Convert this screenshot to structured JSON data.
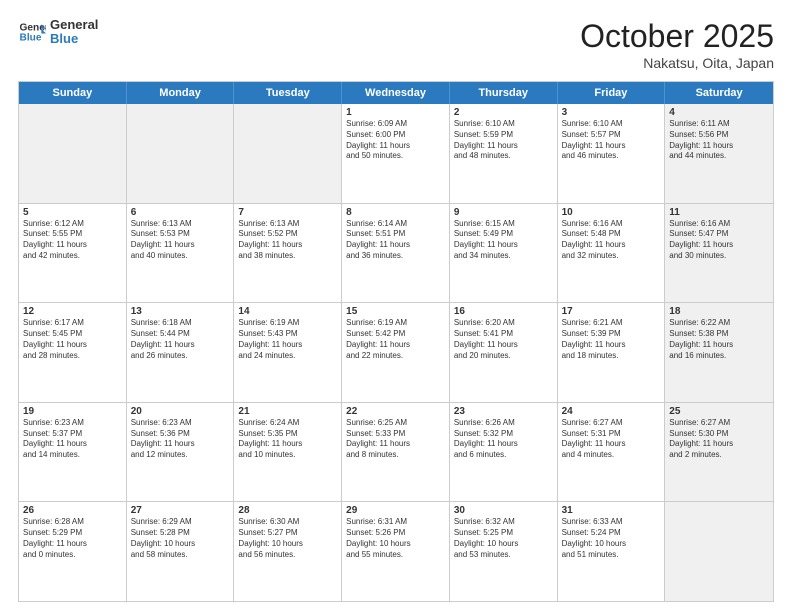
{
  "header": {
    "logo_general": "General",
    "logo_blue": "Blue",
    "month_title": "October 2025",
    "location": "Nakatsu, Oita, Japan"
  },
  "weekdays": [
    "Sunday",
    "Monday",
    "Tuesday",
    "Wednesday",
    "Thursday",
    "Friday",
    "Saturday"
  ],
  "rows": [
    [
      {
        "day": "",
        "info": "",
        "shaded": true
      },
      {
        "day": "",
        "info": "",
        "shaded": true
      },
      {
        "day": "",
        "info": "",
        "shaded": true
      },
      {
        "day": "1",
        "info": "Sunrise: 6:09 AM\nSunset: 6:00 PM\nDaylight: 11 hours\nand 50 minutes."
      },
      {
        "day": "2",
        "info": "Sunrise: 6:10 AM\nSunset: 5:59 PM\nDaylight: 11 hours\nand 48 minutes."
      },
      {
        "day": "3",
        "info": "Sunrise: 6:10 AM\nSunset: 5:57 PM\nDaylight: 11 hours\nand 46 minutes."
      },
      {
        "day": "4",
        "info": "Sunrise: 6:11 AM\nSunset: 5:56 PM\nDaylight: 11 hours\nand 44 minutes.",
        "shaded": true
      }
    ],
    [
      {
        "day": "5",
        "info": "Sunrise: 6:12 AM\nSunset: 5:55 PM\nDaylight: 11 hours\nand 42 minutes."
      },
      {
        "day": "6",
        "info": "Sunrise: 6:13 AM\nSunset: 5:53 PM\nDaylight: 11 hours\nand 40 minutes."
      },
      {
        "day": "7",
        "info": "Sunrise: 6:13 AM\nSunset: 5:52 PM\nDaylight: 11 hours\nand 38 minutes."
      },
      {
        "day": "8",
        "info": "Sunrise: 6:14 AM\nSunset: 5:51 PM\nDaylight: 11 hours\nand 36 minutes."
      },
      {
        "day": "9",
        "info": "Sunrise: 6:15 AM\nSunset: 5:49 PM\nDaylight: 11 hours\nand 34 minutes."
      },
      {
        "day": "10",
        "info": "Sunrise: 6:16 AM\nSunset: 5:48 PM\nDaylight: 11 hours\nand 32 minutes."
      },
      {
        "day": "11",
        "info": "Sunrise: 6:16 AM\nSunset: 5:47 PM\nDaylight: 11 hours\nand 30 minutes.",
        "shaded": true
      }
    ],
    [
      {
        "day": "12",
        "info": "Sunrise: 6:17 AM\nSunset: 5:45 PM\nDaylight: 11 hours\nand 28 minutes."
      },
      {
        "day": "13",
        "info": "Sunrise: 6:18 AM\nSunset: 5:44 PM\nDaylight: 11 hours\nand 26 minutes."
      },
      {
        "day": "14",
        "info": "Sunrise: 6:19 AM\nSunset: 5:43 PM\nDaylight: 11 hours\nand 24 minutes."
      },
      {
        "day": "15",
        "info": "Sunrise: 6:19 AM\nSunset: 5:42 PM\nDaylight: 11 hours\nand 22 minutes."
      },
      {
        "day": "16",
        "info": "Sunrise: 6:20 AM\nSunset: 5:41 PM\nDaylight: 11 hours\nand 20 minutes."
      },
      {
        "day": "17",
        "info": "Sunrise: 6:21 AM\nSunset: 5:39 PM\nDaylight: 11 hours\nand 18 minutes."
      },
      {
        "day": "18",
        "info": "Sunrise: 6:22 AM\nSunset: 5:38 PM\nDaylight: 11 hours\nand 16 minutes.",
        "shaded": true
      }
    ],
    [
      {
        "day": "19",
        "info": "Sunrise: 6:23 AM\nSunset: 5:37 PM\nDaylight: 11 hours\nand 14 minutes."
      },
      {
        "day": "20",
        "info": "Sunrise: 6:23 AM\nSunset: 5:36 PM\nDaylight: 11 hours\nand 12 minutes."
      },
      {
        "day": "21",
        "info": "Sunrise: 6:24 AM\nSunset: 5:35 PM\nDaylight: 11 hours\nand 10 minutes."
      },
      {
        "day": "22",
        "info": "Sunrise: 6:25 AM\nSunset: 5:33 PM\nDaylight: 11 hours\nand 8 minutes."
      },
      {
        "day": "23",
        "info": "Sunrise: 6:26 AM\nSunset: 5:32 PM\nDaylight: 11 hours\nand 6 minutes."
      },
      {
        "day": "24",
        "info": "Sunrise: 6:27 AM\nSunset: 5:31 PM\nDaylight: 11 hours\nand 4 minutes."
      },
      {
        "day": "25",
        "info": "Sunrise: 6:27 AM\nSunset: 5:30 PM\nDaylight: 11 hours\nand 2 minutes.",
        "shaded": true
      }
    ],
    [
      {
        "day": "26",
        "info": "Sunrise: 6:28 AM\nSunset: 5:29 PM\nDaylight: 11 hours\nand 0 minutes."
      },
      {
        "day": "27",
        "info": "Sunrise: 6:29 AM\nSunset: 5:28 PM\nDaylight: 10 hours\nand 58 minutes."
      },
      {
        "day": "28",
        "info": "Sunrise: 6:30 AM\nSunset: 5:27 PM\nDaylight: 10 hours\nand 56 minutes."
      },
      {
        "day": "29",
        "info": "Sunrise: 6:31 AM\nSunset: 5:26 PM\nDaylight: 10 hours\nand 55 minutes."
      },
      {
        "day": "30",
        "info": "Sunrise: 6:32 AM\nSunset: 5:25 PM\nDaylight: 10 hours\nand 53 minutes."
      },
      {
        "day": "31",
        "info": "Sunrise: 6:33 AM\nSunset: 5:24 PM\nDaylight: 10 hours\nand 51 minutes."
      },
      {
        "day": "",
        "info": "",
        "shaded": true
      }
    ]
  ]
}
